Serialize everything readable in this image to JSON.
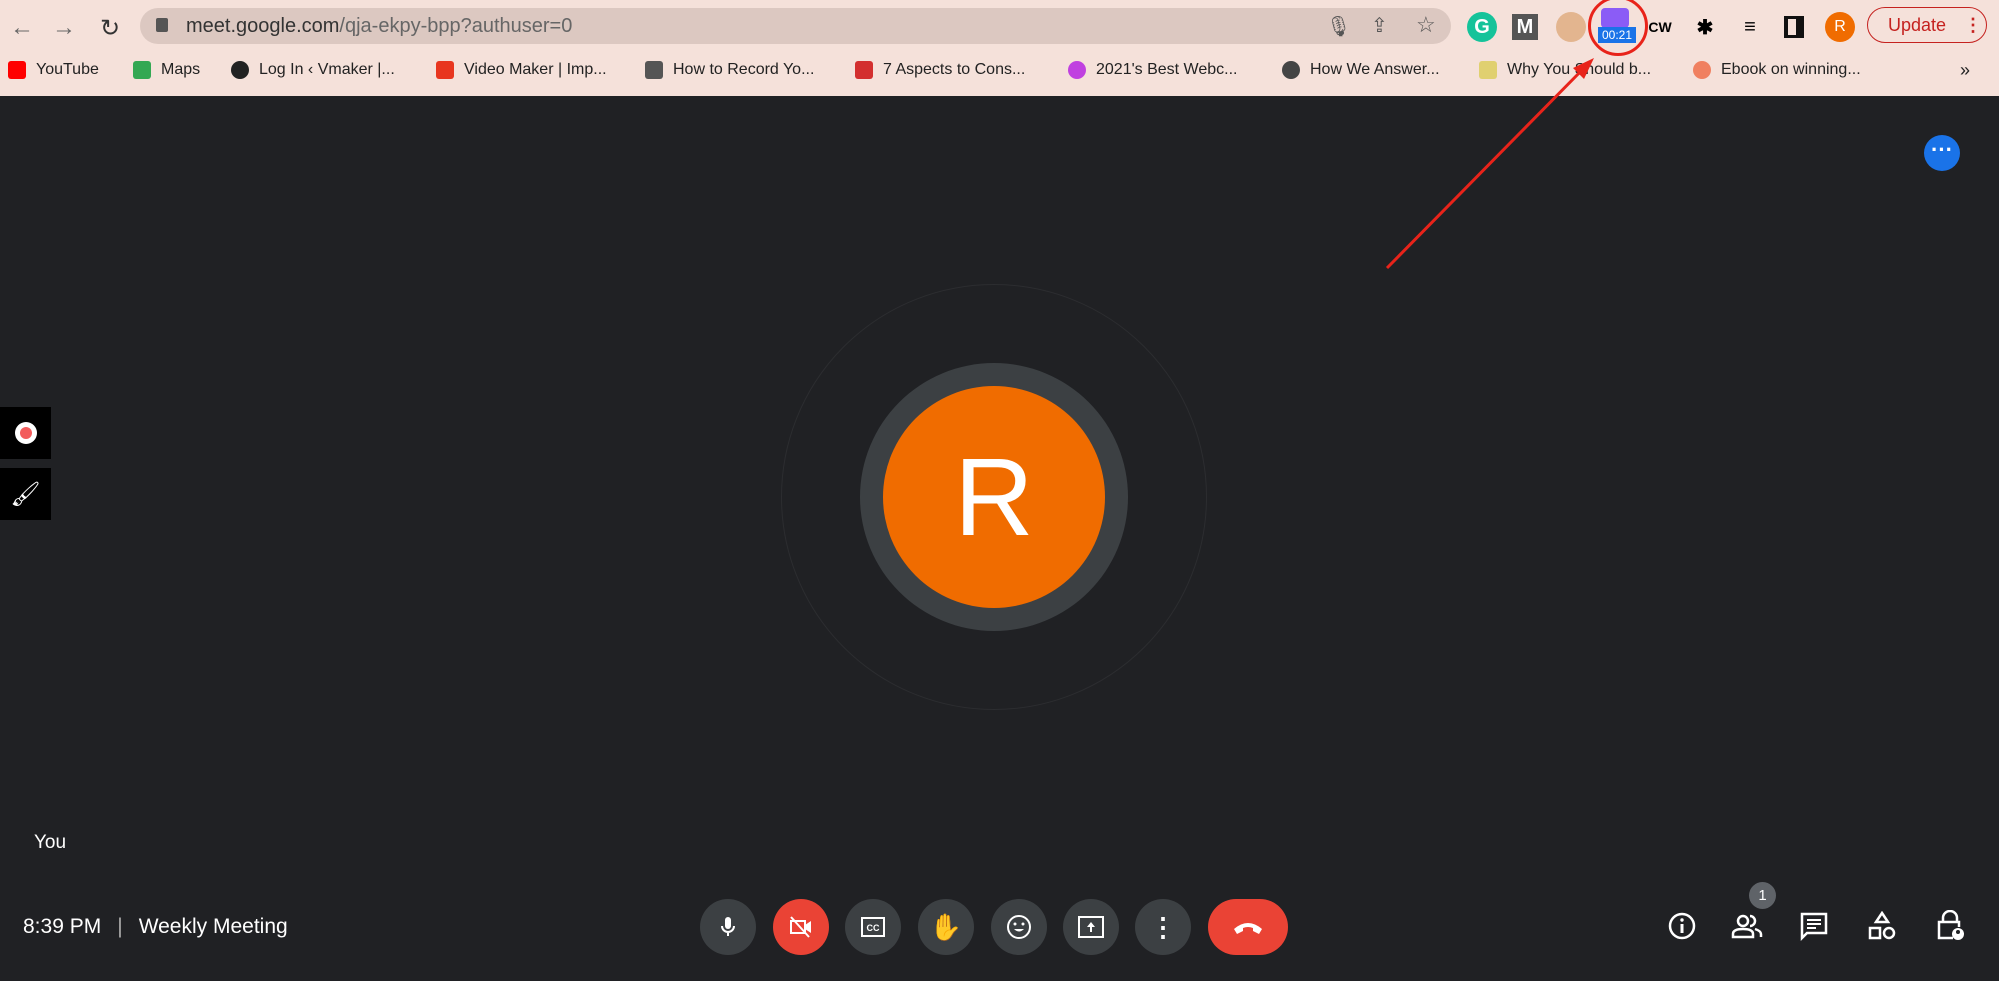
{
  "browser": {
    "url_host": "meet.google.com",
    "url_path": "/qja-ekpy-bpp?authuser=0",
    "update_label": "Update",
    "profile_initial": "R",
    "recorder_timer": "00:21",
    "bookmarks": [
      {
        "label": "YouTube",
        "color": "#ff0000"
      },
      {
        "label": "Maps",
        "color": "#34a853"
      },
      {
        "label": "Log In ‹ Vmaker |...",
        "color": "#222222"
      },
      {
        "label": "Video Maker | Imp...",
        "color": "#e8361f"
      },
      {
        "label": "How to Record Yo...",
        "color": "#555555"
      },
      {
        "label": "7 Aspects to Cons...",
        "color": "#d32f2f"
      },
      {
        "label": "2021's Best Webc...",
        "color": "#c040e0"
      },
      {
        "label": "How We Answer...",
        "color": "#444444"
      },
      {
        "label": "Why You Should b...",
        "color": "#e0d070"
      },
      {
        "label": "Ebook on winning...",
        "color": "#f08060"
      }
    ],
    "more_bookmarks": "»"
  },
  "meeting": {
    "participant_initial": "R",
    "participant_label": "You",
    "time": "8:39 PM",
    "separator": "|",
    "title": "Weekly Meeting",
    "participants_count": "1",
    "colors": {
      "avatar": "#f06c00",
      "background": "#202124",
      "danger": "#ea4335",
      "accent": "#1a73e8"
    }
  }
}
